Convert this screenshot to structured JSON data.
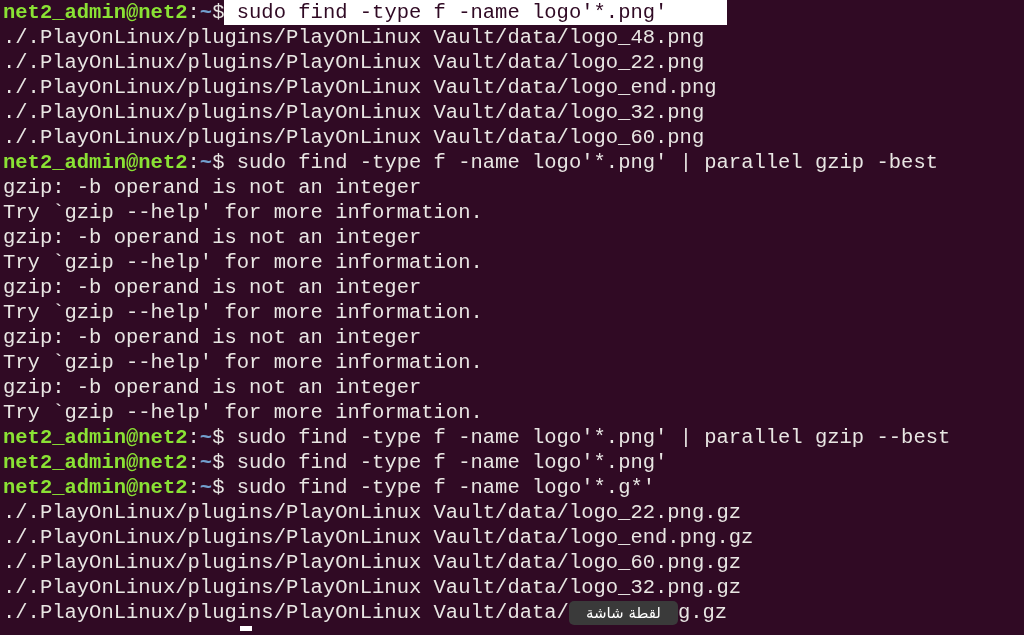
{
  "lines": [
    {
      "kind": "prompt",
      "user": "net2_admin@net2",
      "sep": ":",
      "path": "~",
      "sign": "$",
      "command": " sudo find -type f -name logo'*.png'",
      "selected": true
    },
    {
      "kind": "output",
      "text": "./.PlayOnLinux/plugins/PlayOnLinux Vault/data/logo_48.png"
    },
    {
      "kind": "output",
      "text": "./.PlayOnLinux/plugins/PlayOnLinux Vault/data/logo_22.png"
    },
    {
      "kind": "output",
      "text": "./.PlayOnLinux/plugins/PlayOnLinux Vault/data/logo_end.png"
    },
    {
      "kind": "output",
      "text": "./.PlayOnLinux/plugins/PlayOnLinux Vault/data/logo_32.png"
    },
    {
      "kind": "output",
      "text": "./.PlayOnLinux/plugins/PlayOnLinux Vault/data/logo_60.png"
    },
    {
      "kind": "prompt",
      "user": "net2_admin@net2",
      "sep": ":",
      "path": "~",
      "sign": "$",
      "command": " sudo find -type f -name logo'*.png' | parallel gzip -best",
      "selected": false
    },
    {
      "kind": "output",
      "text": "gzip: -b operand is not an integer"
    },
    {
      "kind": "output",
      "text": "Try `gzip --help' for more information."
    },
    {
      "kind": "output",
      "text": "gzip: -b operand is not an integer"
    },
    {
      "kind": "output",
      "text": "Try `gzip --help' for more information."
    },
    {
      "kind": "output",
      "text": "gzip: -b operand is not an integer"
    },
    {
      "kind": "output",
      "text": "Try `gzip --help' for more information."
    },
    {
      "kind": "output",
      "text": "gzip: -b operand is not an integer"
    },
    {
      "kind": "output",
      "text": "Try `gzip --help' for more information."
    },
    {
      "kind": "output",
      "text": "gzip: -b operand is not an integer"
    },
    {
      "kind": "output",
      "text": "Try `gzip --help' for more information."
    },
    {
      "kind": "prompt",
      "user": "net2_admin@net2",
      "sep": ":",
      "path": "~",
      "sign": "$",
      "command": " sudo find -type f -name logo'*.png' | parallel gzip --best",
      "selected": false
    },
    {
      "kind": "prompt",
      "user": "net2_admin@net2",
      "sep": ":",
      "path": "~",
      "sign": "$",
      "command": " sudo find -type f -name logo'*.png'",
      "selected": false
    },
    {
      "kind": "prompt",
      "user": "net2_admin@net2",
      "sep": ":",
      "path": "~",
      "sign": "$",
      "command": " sudo find -type f -name logo'*.g*'",
      "selected": false
    },
    {
      "kind": "output",
      "text": "./.PlayOnLinux/plugins/PlayOnLinux Vault/data/logo_22.png.gz"
    },
    {
      "kind": "output",
      "text": "./.PlayOnLinux/plugins/PlayOnLinux Vault/data/logo_end.png.gz"
    },
    {
      "kind": "output",
      "text": "./.PlayOnLinux/plugins/PlayOnLinux Vault/data/logo_60.png.gz"
    },
    {
      "kind": "output",
      "text": "./.PlayOnLinux/plugins/PlayOnLinux Vault/data/logo_32.png.gz"
    },
    {
      "kind": "covered",
      "before": "./.PlayOnLinux/plugins/PlayOnLinux Vault/data/",
      "tooltip": "لقطة شاشة",
      "after": "g.gz"
    }
  ]
}
